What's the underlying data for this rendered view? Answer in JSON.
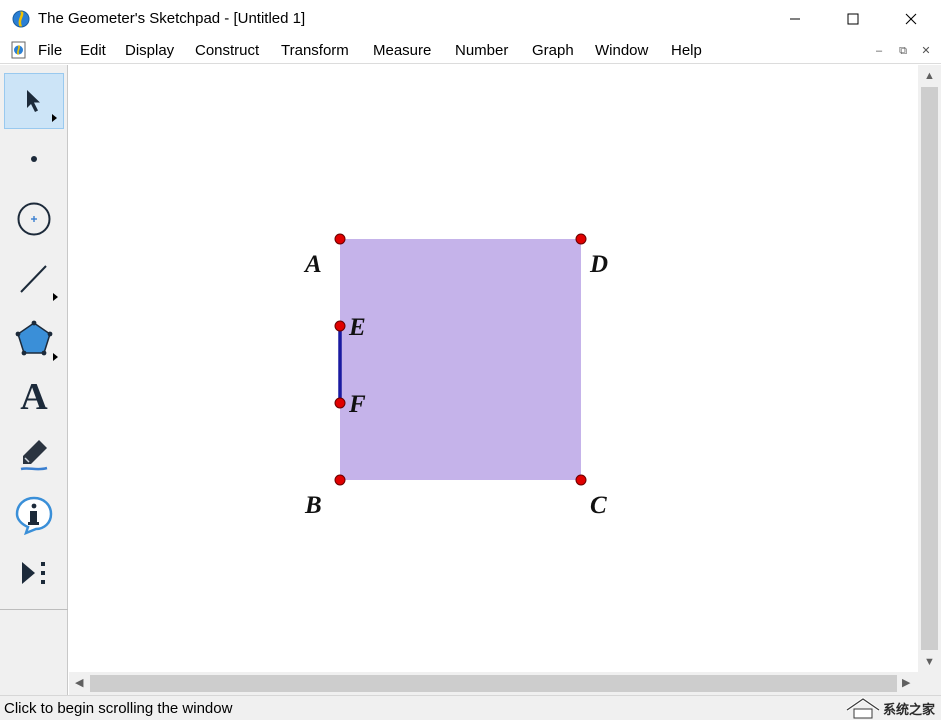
{
  "window": {
    "title": "The Geometer's Sketchpad - [Untitled 1]",
    "controls": [
      "minimize",
      "maximize",
      "close"
    ]
  },
  "menu": {
    "items": [
      "File",
      "Edit",
      "Display",
      "Construct",
      "Transform",
      "Measure",
      "Number",
      "Graph",
      "Window",
      "Help"
    ],
    "mdi_minimize": "–",
    "mdi_restore": "⧉",
    "mdi_close": "✕"
  },
  "toolbox": {
    "tools": [
      {
        "name": "arrow-tool",
        "selected": true
      },
      {
        "name": "point-tool"
      },
      {
        "name": "compass-tool"
      },
      {
        "name": "straightedge-tool"
      },
      {
        "name": "polygon-tool"
      },
      {
        "name": "text-tool",
        "glyph": "A"
      },
      {
        "name": "marker-tool"
      },
      {
        "name": "information-tool"
      },
      {
        "name": "custom-tool"
      }
    ]
  },
  "sketch": {
    "polygon_fill": "#c5b3ea",
    "point_color": "#e00000",
    "segment_color": "#1a1aa0",
    "points": {
      "A": {
        "label": "A"
      },
      "B": {
        "label": "B"
      },
      "C": {
        "label": "C"
      },
      "D": {
        "label": "D"
      },
      "E": {
        "label": "E"
      },
      "F": {
        "label": "F"
      }
    }
  },
  "status": {
    "text": "Click to begin scrolling the window"
  },
  "watermark": {
    "text": "系统之家"
  }
}
